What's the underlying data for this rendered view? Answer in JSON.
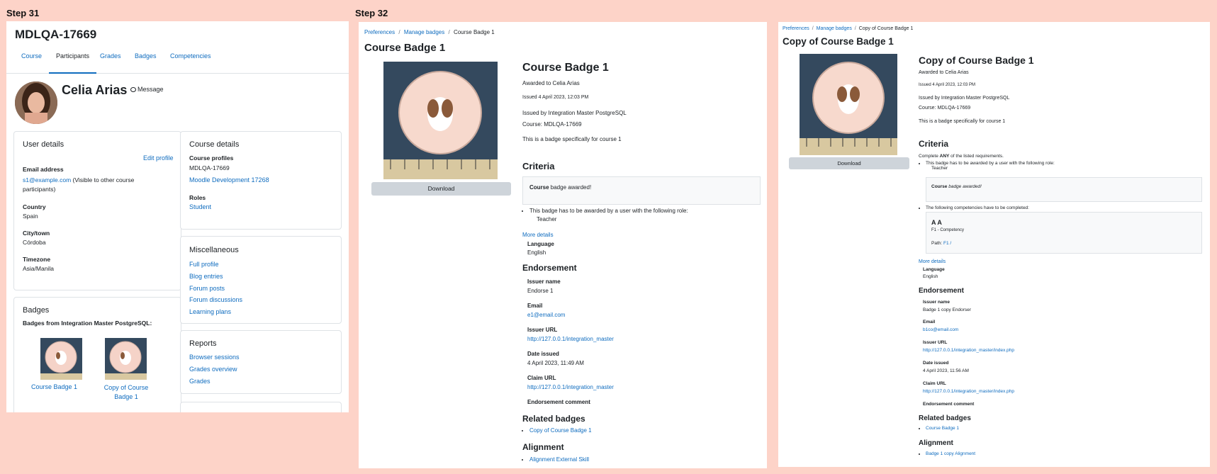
{
  "steps": {
    "left": "Step 31",
    "right": "Step 32"
  },
  "profile": {
    "course_title": "MDLQA-17669",
    "tabs": [
      "Course",
      "Participants",
      "Grades",
      "Badges",
      "Competencies"
    ],
    "active_tab": "Participants",
    "user_name": "Celia Arias",
    "message_label": "Message",
    "user_details": {
      "title": "User details",
      "edit_profile": "Edit profile",
      "email_label": "Email address",
      "email_value": "s1@example.com",
      "email_note": "(Visible to other course",
      "email_note2": "participants)",
      "country_label": "Country",
      "country_value": "Spain",
      "city_label": "City/town",
      "city_value": "Córdoba",
      "tz_label": "Timezone",
      "tz_value": "Asia/Manila"
    },
    "course_details": {
      "title": "Course details",
      "profiles_label": "Course profiles",
      "profile1": "MDLQA-17669",
      "profile2": "Moodle Development 17268",
      "roles_label": "Roles",
      "role": "Student"
    },
    "misc": {
      "title": "Miscellaneous",
      "items": [
        "Full profile",
        "Blog entries",
        "Forum posts",
        "Forum discussions",
        "Learning plans"
      ]
    },
    "reports": {
      "title": "Reports",
      "items": [
        "Browser sessions",
        "Grades overview",
        "Grades"
      ]
    },
    "badges": {
      "title": "Badges",
      "subtitle": "Badges from Integration Master PostgreSQL:",
      "b1": "Course Badge 1",
      "b2a": "Copy of Course",
      "b2b": "Badge 1"
    }
  },
  "badge1": {
    "breadcrumb": [
      "Preferences",
      "Manage badges",
      "Course Badge 1"
    ],
    "page_title": "Course Badge 1",
    "download": "Download",
    "name": "Course Badge 1",
    "awarded_to": "Awarded to Celia Arias",
    "issued": "Issued 4 April 2023, 12:03 PM",
    "issued_by": "Issued by Integration Master PostgreSQL",
    "course": "Course: MDLQA-17669",
    "description": "This is a badge specifically for course 1",
    "criteria_title": "Criteria",
    "criteria_box_b": "Course",
    "criteria_box_rest": " badge awarded!",
    "criteria_item": "This badge has to be awarded by a user with the following role:",
    "criteria_role": "Teacher",
    "more_details": "More details",
    "language_label": "Language",
    "language_value": "English",
    "endorsement_title": "Endorsement",
    "issuer_name_label": "Issuer name",
    "issuer_name_value": "Endorse 1",
    "email_label": "Email",
    "email_value": "e1@email.com",
    "issuer_url_label": "Issuer URL",
    "issuer_url_value": "http://127.0.0.1/integration_master",
    "date_label": "Date issued",
    "date_value": "4 April 2023, 11:49 AM",
    "claim_label": "Claim URL",
    "claim_value": "http://127.0.0.1/integration_master",
    "comment_label": "Endorsement comment",
    "related_title": "Related badges",
    "related_item": "Copy of Course Badge 1",
    "alignment_title": "Alignment",
    "alignment_item": "Alignment External Skill"
  },
  "badge2": {
    "breadcrumb": [
      "Preferences",
      "Manage badges",
      "Copy of Course Badge 1"
    ],
    "page_title": "Copy of Course Badge 1",
    "download": "Download",
    "name": "Copy of Course Badge 1",
    "awarded_to": "Awarded to Celia Arias",
    "issued": "Issued 4 April 2023, 12:03 PM",
    "issued_by": "Issued by Integration Master PostgreSQL",
    "course": "Course: MDLQA-17669",
    "description": "This is a badge specifically for course 1",
    "criteria_title": "Criteria",
    "criteria_intro_a": "Complete ",
    "criteria_intro_b": "ANY",
    "criteria_intro_c": " of the listed requirements.",
    "criteria_item": "This badge has to be awarded by a user with the following role:",
    "criteria_role": "Teacher",
    "criteria_box_b": "Course",
    "criteria_box_rest": " badge awarded!",
    "competency_item": "The following competencies have to be completed:",
    "comp_name": "A A",
    "comp_sub": "F1 - Competency",
    "comp_path_label": "Path: ",
    "comp_path_value": "F1 /",
    "more_details": "More details",
    "language_label": "Language",
    "language_value": "English",
    "endorsement_title": "Endorsement",
    "issuer_name_label": "Issuer name",
    "issuer_name_value": "Badge 1 copy Endorser",
    "email_label": "Email",
    "email_value": "b1co@email.com",
    "issuer_url_label": "Issuer URL",
    "issuer_url_value": "http://127.0.0.1/integration_master/index.php",
    "date_label": "Date issued",
    "date_value": "4 April 2023, 11:56 AM",
    "claim_label": "Claim URL",
    "claim_value": "http://127.0.0.1/integration_master/index.php",
    "comment_label": "Endorsement comment",
    "related_title": "Related badges",
    "related_item": "Course Badge 1",
    "alignment_title": "Alignment",
    "alignment_item": "Badge 1 copy Alignment"
  }
}
